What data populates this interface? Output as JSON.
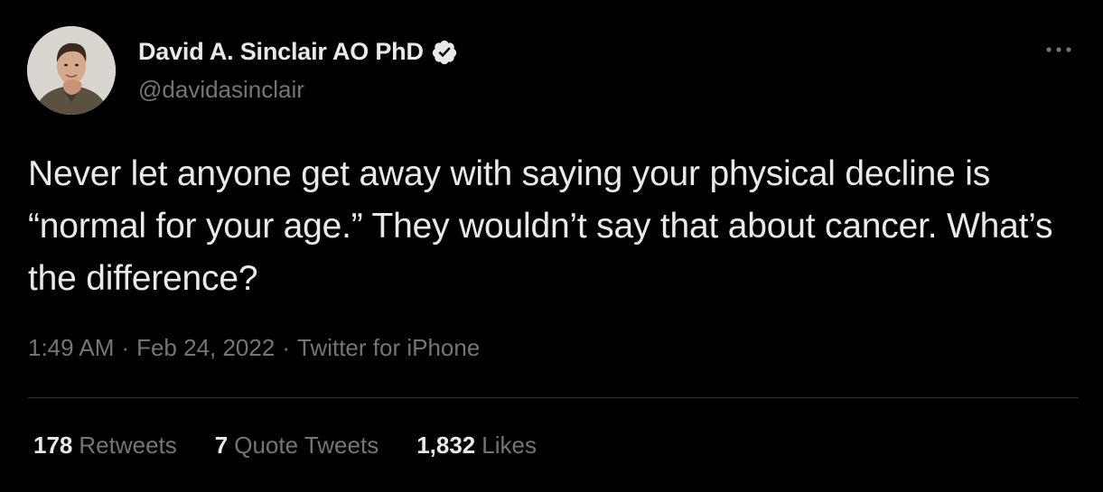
{
  "author": {
    "name": "David A. Sinclair AO PhD",
    "handle": "@davidasinclair",
    "verified": true,
    "avatar": "author-avatar-photo"
  },
  "tweet": {
    "text": "Never let anyone get away with saying your physical decline is “normal for your age.” They wouldn’t say that about cancer. What’s the difference?",
    "time": "1:49 AM",
    "date": "Feb 24, 2022",
    "source": "Twitter for iPhone",
    "separator": "·"
  },
  "stats": {
    "retweets": {
      "count": "178",
      "label": "Retweets"
    },
    "quote_tweets": {
      "count": "7",
      "label": "Quote Tweets"
    },
    "likes": {
      "count": "1,832",
      "label": "Likes"
    }
  },
  "icons": {
    "verified": "verified-badge-icon",
    "more": "more-options-icon"
  },
  "colors": {
    "background": "#000000",
    "primary_text": "#e7e9ea",
    "secondary_text": "#71767b",
    "divider": "#2f3336"
  }
}
